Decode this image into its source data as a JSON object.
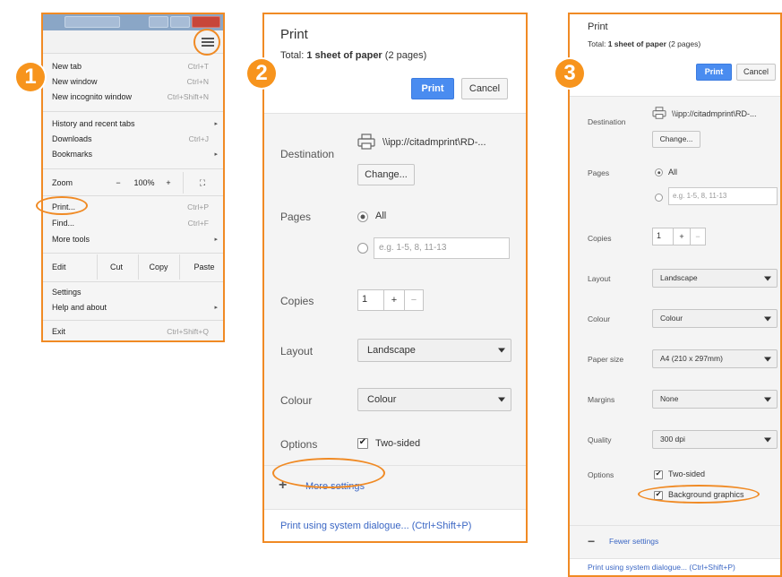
{
  "badges": [
    "1",
    "2",
    "3"
  ],
  "menu": {
    "items_top": [
      {
        "label": "New tab",
        "shortcut": "Ctrl+T"
      },
      {
        "label": "New window",
        "shortcut": "Ctrl+N"
      },
      {
        "label": "New incognito window",
        "shortcut": "Ctrl+Shift+N"
      }
    ],
    "items_mid": [
      {
        "label": "History and recent tabs",
        "shortcut": "",
        "arrow": "▸"
      },
      {
        "label": "Downloads",
        "shortcut": "Ctrl+J"
      },
      {
        "label": "Bookmarks",
        "shortcut": "",
        "arrow": "▸"
      }
    ],
    "zoom": {
      "label": "Zoom",
      "minus": "−",
      "value": "100%",
      "plus": "+",
      "fullscreen": "⛶"
    },
    "items_print": [
      {
        "label": "Print...",
        "shortcut": "Ctrl+P"
      },
      {
        "label": "Find...",
        "shortcut": "Ctrl+F"
      },
      {
        "label": "More tools",
        "shortcut": "",
        "arrow": "▸"
      }
    ],
    "edit": {
      "label": "Edit",
      "cut": "Cut",
      "copy": "Copy",
      "paste": "Paste"
    },
    "items_settings": [
      {
        "label": "Settings",
        "shortcut": ""
      },
      {
        "label": "Help and about",
        "shortcut": "",
        "arrow": "▸"
      }
    ],
    "exit": {
      "label": "Exit",
      "shortcut": "Ctrl+Shift+Q"
    }
  },
  "print": {
    "title": "Print",
    "total_prefix": "Total: ",
    "total_bold": "1 sheet of paper",
    "total_suffix": " (2 pages)",
    "print_button": "Print",
    "cancel_button": "Cancel",
    "destination_label": "Destination",
    "destination_value": "\\\\ipp://citadmprint\\RD-...",
    "change_button": "Change...",
    "pages_label": "Pages",
    "pages_all": "All",
    "pages_placeholder": "e.g. 1-5, 8, 11-13",
    "copies_label": "Copies",
    "copies_value": "1",
    "copies_plus": "+",
    "copies_minus": "−",
    "layout_label": "Layout",
    "layout_value": "Landscape",
    "colour_label": "Colour",
    "colour_value": "Colour",
    "paper_label": "Paper size",
    "paper_value": "A4 (210 x 297mm)",
    "margins_label": "Margins",
    "margins_value": "None",
    "quality_label": "Quality",
    "quality_value": "300 dpi",
    "options_label": "Options",
    "two_sided": "Two-sided",
    "background_graphics": "Background graphics",
    "more_settings": "More settings",
    "more_icon": "+",
    "fewer_settings": "Fewer settings",
    "fewer_icon": "−",
    "system_dialog": "Print using system dialogue... (Ctrl+Shift+P)"
  },
  "colors": {
    "accent": "#f08a24",
    "print_blue": "#4a8cf0"
  }
}
